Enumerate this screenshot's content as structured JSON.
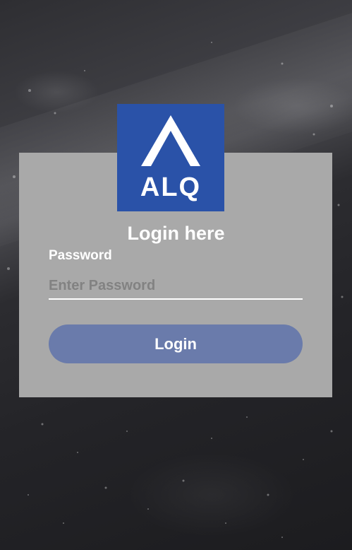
{
  "brand": {
    "logo_text": "ALQ",
    "logo_color": "#2a52a8"
  },
  "login_form": {
    "title": "Login here",
    "password_label": "Password",
    "password_placeholder": "Enter Password",
    "password_value": "",
    "submit_label": "Login",
    "card_color": "#a9a9a9",
    "button_color": "#6a7bab"
  }
}
